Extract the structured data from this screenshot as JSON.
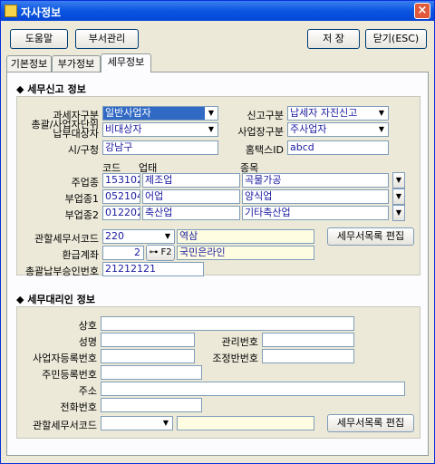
{
  "window": {
    "title": "자사정보",
    "close_label": "×"
  },
  "toolbar": {
    "help": "도움말",
    "dept": "부서관리",
    "save": "저 장",
    "close": "닫기(ESC)"
  },
  "tabs": [
    "기본정보",
    "부가정보",
    "세무정보"
  ],
  "tax": {
    "section_title": "세무신고 정보",
    "labels": {
      "taxpayer_type": "과세자구분",
      "filing_type": "신고구분",
      "consolidated": "총괄/사업자단위 납부대상자",
      "business_type": "사업장구분",
      "city": "시/구청",
      "hometax_id": "홈택스ID",
      "col_code": "코드",
      "col_business": "업태",
      "col_item": "종목",
      "main_biz": "주업종",
      "sub_biz1": "부업종1",
      "sub_biz2": "부업종2",
      "office_code": "관할세무서코드",
      "refund_account": "환급계좌",
      "approval_no": "총괄납부승인번호"
    },
    "values": {
      "taxpayer_type": "일반사업자",
      "filing_type": "납세자 자진신고",
      "consolidated": "비대상자",
      "business_type": "주사업자",
      "city": "강남구",
      "hometax_id": "abcd",
      "main_biz": {
        "code": "153102",
        "business": "제조업",
        "item": "곡물가공"
      },
      "sub_biz1": {
        "code": "052104",
        "business": "어업",
        "item": "양식업"
      },
      "sub_biz2": {
        "code": "012202",
        "business": "축산업",
        "item": "기타축산업"
      },
      "office_code": "220",
      "office_name": "역삼",
      "refund_no": "2",
      "refund_key": "F2",
      "refund_bank": "국민은라인",
      "approval_no": "21212121"
    },
    "office_edit": "세무서목록 편집"
  },
  "agent": {
    "section_title": "세무대리인 정보",
    "labels": {
      "name": "상호",
      "person": "성명",
      "mgmt_no": "관리번호",
      "biz_reg_no": "사업자등록번호",
      "adjust_no": "조정반번호",
      "resident_no": "주민등록번호",
      "address": "주소",
      "phone": "전화번호",
      "office_code": "관할세무서코드"
    },
    "office_edit": "세무서목록 편집"
  }
}
